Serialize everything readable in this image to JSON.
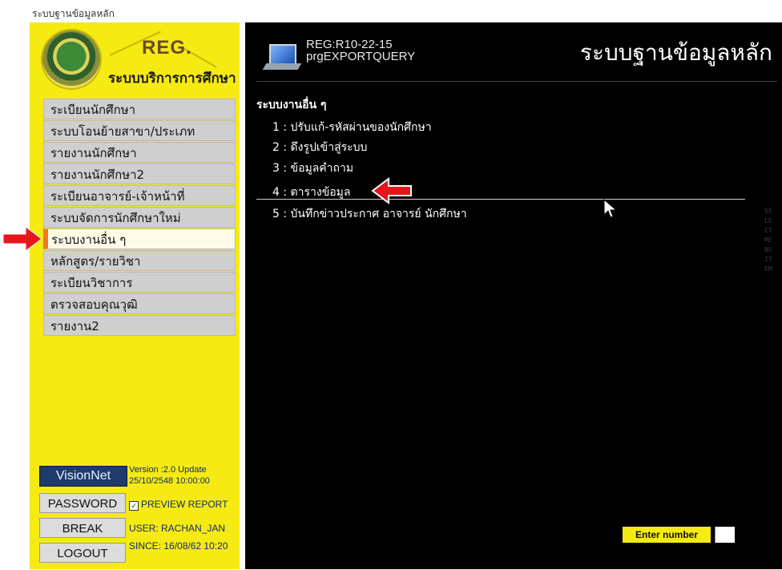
{
  "window": {
    "title": "ระบบฐานข้อมูลหลัก"
  },
  "branding": {
    "logo_title": "REG.",
    "logo_subtitle": "ระบบบริการการศึกษา"
  },
  "sidebar": {
    "items": [
      {
        "label": "ระเบียนนักศึกษา"
      },
      {
        "label": "ระบบโอนย้ายสาขา/ประเภท"
      },
      {
        "label": "รายงานนักศึกษา"
      },
      {
        "label": "รายงานนักศึกษา2"
      },
      {
        "label": "ระเบียนอาจารย์-เจ้าหน้าที่"
      },
      {
        "label": "ระบบจัดการนักศึกษาใหม่"
      },
      {
        "label": "ระบบงานอื่น ๆ",
        "active": true
      },
      {
        "label": "หลักสูตร/รายวิชา"
      },
      {
        "label": "ระเบียนวิชาการ"
      },
      {
        "label": "ตรวจสอบคุณวุฒิ"
      },
      {
        "label": "รายงาน2"
      }
    ]
  },
  "footer": {
    "vendor_logo": "VisionNet",
    "version_line1": "Version :2.0 Update",
    "version_line2": "25/10/2548 10:00:00",
    "password_label": "PASSWORD",
    "preview_report_label": "PREVIEW REPORT",
    "preview_report_checked": true,
    "break_label": "BREAK",
    "user_text": "USER: RACHAN_JAN",
    "logout_label": "LOGOUT",
    "since_text": "SINCE: 16/08/62 10:20"
  },
  "header": {
    "program_code": "REG:R10-22-15",
    "program_name": "prgEXPORTQUERY",
    "system_title": "ระบบฐานข้อมูลหลัก"
  },
  "main": {
    "section_title": "ระบบงานอื่น ๆ",
    "options": [
      {
        "label": "1 : ปรับแก้-รหัสผ่านของนักศึกษา"
      },
      {
        "label": "2 : ดึงรูปเข้าสู่ระบบ"
      },
      {
        "label": "3 : ข้อมูลคำถาม"
      },
      {
        "label": "4 : ตารางข้อมูล",
        "selected": true
      },
      {
        "label": "5 : บันทึกข่าวประกาศ อาจารย์ นักศึกษา"
      }
    ],
    "side_hint": "SELECT MENU ITEM",
    "enter_number_label": "Enter number",
    "enter_number_value": ""
  },
  "colors": {
    "sidebar_bg": "#f5ea12",
    "main_bg": "#000000",
    "active_marker": "#f07a20",
    "annotation_arrow": "#e8141b"
  }
}
